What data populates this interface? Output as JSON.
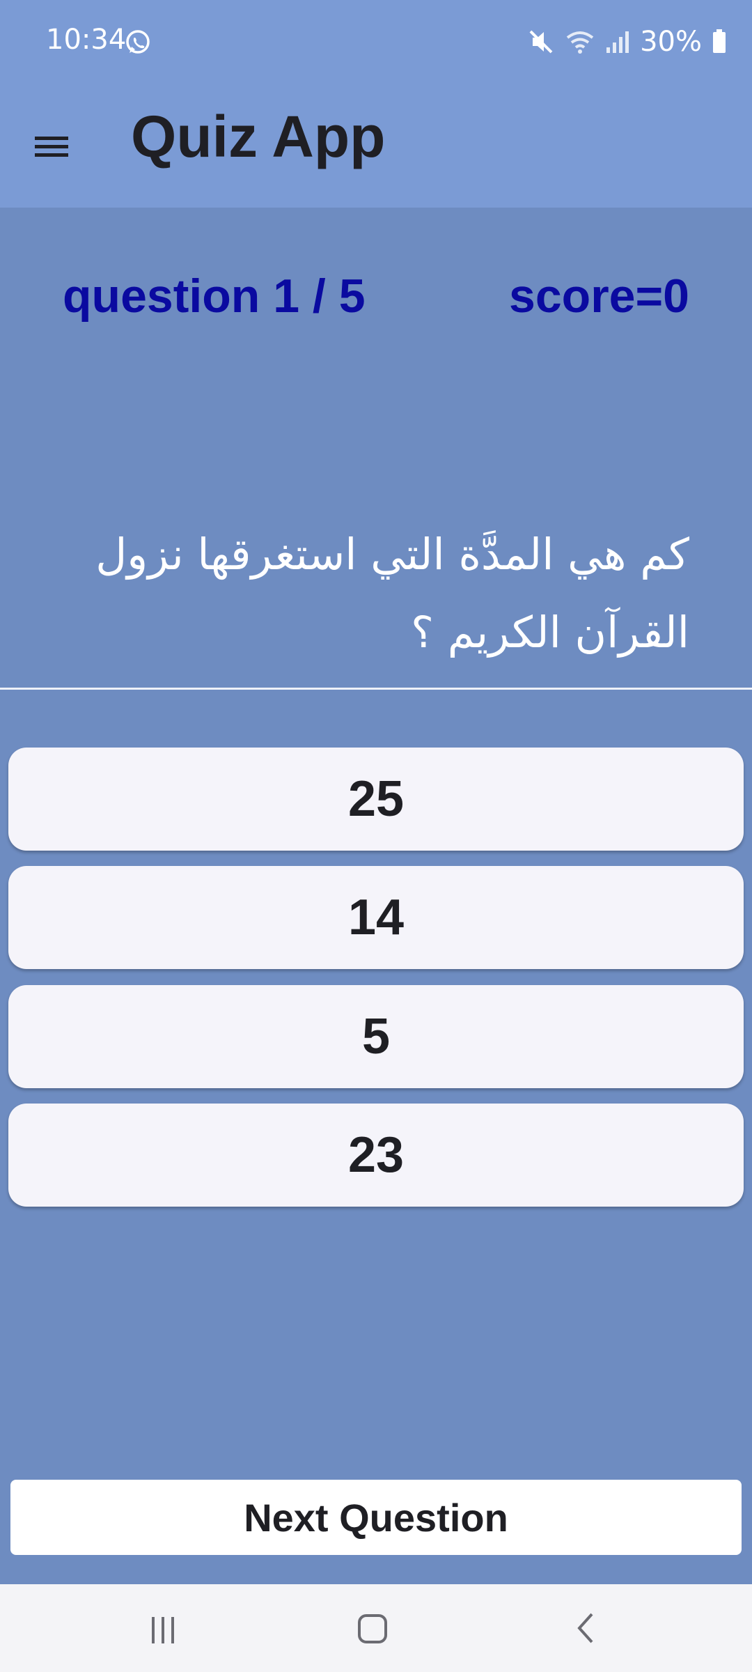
{
  "status_bar": {
    "time": "10:34",
    "app_icon": "whatsapp-icon",
    "icons": [
      "mute-icon",
      "wifi-icon",
      "signal-icon",
      "battery-icon"
    ],
    "battery": "30%"
  },
  "app_bar": {
    "title": "Quiz App",
    "menu_icon": "hamburger-menu-icon"
  },
  "quiz": {
    "question_counter": "question 1 / 5",
    "score": "score=0",
    "question": "كم هي المدَّة التي استغرقها نزول القرآن الكريم ؟",
    "answers": [
      "25",
      "14",
      "5",
      "23"
    ],
    "next_label": "Next Question"
  },
  "nav_bar": {
    "buttons": [
      "recents-icon",
      "home-icon",
      "back-icon"
    ]
  },
  "colors": {
    "background": "#6e8cc1",
    "app_bar": "#7b9bd5",
    "header_text": "#0a0aa0",
    "answer_bg": "#f5f4fa"
  }
}
